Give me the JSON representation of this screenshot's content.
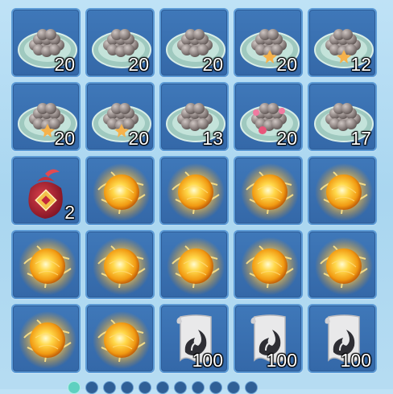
{
  "items": [
    {
      "icon": "grey-dumplings-plate-icon",
      "qty": "20"
    },
    {
      "icon": "grey-dumplings-plate-icon",
      "qty": "20"
    },
    {
      "icon": "grey-dumplings-plate-icon",
      "qty": "20"
    },
    {
      "icon": "cream-dumplings-plate-icon",
      "qty": "20"
    },
    {
      "icon": "cream-dumplings-plate-icon",
      "qty": "12"
    },
    {
      "icon": "cream-dumplings-plate-icon",
      "qty": "20"
    },
    {
      "icon": "cream-dumplings-plate-icon",
      "qty": "20"
    },
    {
      "icon": "red-dumplings-plate-icon",
      "qty": "13"
    },
    {
      "icon": "pink-flower-dumplings-plate-icon",
      "qty": "20"
    },
    {
      "icon": "dark-red-dumplings-plate-icon",
      "qty": "17"
    },
    {
      "icon": "lucky-bag-icon",
      "qty": "2"
    },
    {
      "icon": "golden-orb-icon",
      "qty": ""
    },
    {
      "icon": "golden-orb-icon",
      "qty": ""
    },
    {
      "icon": "golden-orb-icon",
      "qty": ""
    },
    {
      "icon": "golden-orb-icon",
      "qty": ""
    },
    {
      "icon": "golden-orb-icon",
      "qty": ""
    },
    {
      "icon": "golden-orb-icon",
      "qty": ""
    },
    {
      "icon": "golden-orb-icon",
      "qty": ""
    },
    {
      "icon": "golden-orb-icon",
      "qty": ""
    },
    {
      "icon": "golden-orb-icon",
      "qty": ""
    },
    {
      "icon": "golden-orb-icon",
      "qty": ""
    },
    {
      "icon": "golden-orb-icon",
      "qty": ""
    },
    {
      "icon": "scroll-icon",
      "qty": "100"
    },
    {
      "icon": "scroll-icon",
      "qty": "100"
    },
    {
      "icon": "scroll-icon",
      "qty": "100"
    }
  ],
  "pagination": {
    "pages": 11,
    "active": 0
  }
}
